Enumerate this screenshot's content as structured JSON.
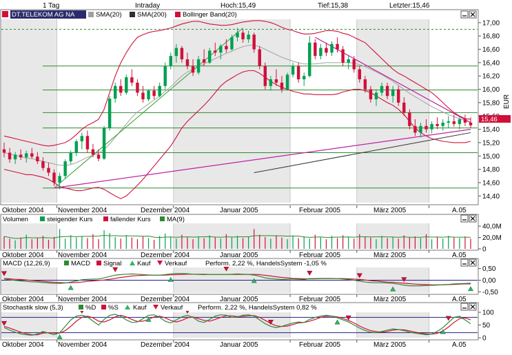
{
  "header": {
    "timeframe": "1 Tag",
    "mode": "Intraday",
    "high": "Hoch:15,49",
    "low": "Tief:15,38",
    "last": "Letzter:15,46"
  },
  "colors": {
    "candle_up": "#00a050",
    "candle_down": "#d0103a",
    "bollinger": "#d0103a",
    "sma20": "#a0a0a0",
    "sma200": "#303030",
    "hline": "#2f8a2f",
    "trend_green": "#2fa02f",
    "trend_magenta": "#c020a0",
    "ma": "#2f8a2f",
    "band_gray": "#e8e8e8",
    "grid_dash": "#2f8a2f"
  },
  "x_labels": [
    "Oktober 2004",
    "November 2004",
    "Dezember 2004",
    "Januar 2005",
    "Februar 2005",
    "März 2005",
    "A.05"
  ],
  "main_legend": {
    "title": "DT.TELEKOM AG NA",
    "items": [
      "SMA(20)",
      "SMA(200)",
      "Bollinger Band(20)"
    ]
  },
  "price_ticks": [
    "17,00",
    "16,80",
    "16,60",
    "16,40",
    "16,20",
    "16,00",
    "15,80",
    "15,60",
    "15,40",
    "15,20",
    "15,00",
    "14,80",
    "14,60",
    "14,40"
  ],
  "currency": "EUR",
  "last_price_label": "15,46",
  "volume_legend": {
    "items": [
      "Volumen",
      "steigender Kurs",
      "fallender Kurs",
      "MA(9)"
    ]
  },
  "volume_ticks": [
    "40,0M",
    "20,0M",
    "0"
  ],
  "macd_legend": {
    "items": [
      "MACD (12,26,9)",
      "MACD",
      "Signal",
      "Kauf",
      "Verkauf",
      "Perform. 2,22 %, HandelsSystem -1,05 %"
    ]
  },
  "macd_ticks": [
    "0,50",
    "0,00",
    "-0,50"
  ],
  "stoch_legend": {
    "items": [
      "Stochastik slow (5,3)",
      "%D",
      "%S",
      "Kauf",
      "Verkauf",
      "Perform. 2,22 %, HandelsSystem 0,82 %"
    ]
  },
  "stoch_ticks": [
    "100",
    "50",
    "0"
  ],
  "chart_data": {
    "type": "candlestick",
    "instrument": "DT.TELEKOM AG NA",
    "period": "Oktober 2004 – April 2005",
    "ylim": [
      14.3,
      17.05
    ],
    "ohlc": [
      [
        15.1,
        15.2,
        14.98,
        15.05
      ],
      [
        15.05,
        15.12,
        14.9,
        14.95
      ],
      [
        14.95,
        15.06,
        14.88,
        15.02
      ],
      [
        15.02,
        15.1,
        14.94,
        14.98
      ],
      [
        14.98,
        15.08,
        14.9,
        15.04
      ],
      [
        15.04,
        15.12,
        14.96,
        14.99
      ],
      [
        14.99,
        15.06,
        14.88,
        14.92
      ],
      [
        14.92,
        14.98,
        14.78,
        14.82
      ],
      [
        14.82,
        14.9,
        14.7,
        14.75
      ],
      [
        14.75,
        14.8,
        14.55,
        14.6
      ],
      [
        14.6,
        14.75,
        14.5,
        14.7
      ],
      [
        14.7,
        14.95,
        14.66,
        14.92
      ],
      [
        14.92,
        15.08,
        14.88,
        15.05
      ],
      [
        15.05,
        15.25,
        15.0,
        15.22
      ],
      [
        15.22,
        15.35,
        15.1,
        15.3
      ],
      [
        15.3,
        15.38,
        15.05,
        15.1
      ],
      [
        15.1,
        15.18,
        14.98,
        15.02
      ],
      [
        15.02,
        15.1,
        14.92,
        14.96
      ],
      [
        14.96,
        15.45,
        14.94,
        15.42
      ],
      [
        15.42,
        15.9,
        15.38,
        15.86
      ],
      [
        15.86,
        16.1,
        15.8,
        16.05
      ],
      [
        16.05,
        16.15,
        15.9,
        15.95
      ],
      [
        15.95,
        16.22,
        15.92,
        16.18
      ],
      [
        16.18,
        16.3,
        16.05,
        16.1
      ],
      [
        16.1,
        16.15,
        15.9,
        15.95
      ],
      [
        15.95,
        16.05,
        15.8,
        15.85
      ],
      [
        15.85,
        16.0,
        15.82,
        15.98
      ],
      [
        15.98,
        16.05,
        15.85,
        15.9
      ],
      [
        15.9,
        16.1,
        15.88,
        16.05
      ],
      [
        16.05,
        16.4,
        16.0,
        16.35
      ],
      [
        16.35,
        16.55,
        16.3,
        16.5
      ],
      [
        16.5,
        16.68,
        16.4,
        16.62
      ],
      [
        16.62,
        16.65,
        16.4,
        16.45
      ],
      [
        16.45,
        16.55,
        16.3,
        16.35
      ],
      [
        16.35,
        16.45,
        16.2,
        16.25
      ],
      [
        16.25,
        16.5,
        16.22,
        16.45
      ],
      [
        16.45,
        16.6,
        16.35,
        16.4
      ],
      [
        16.4,
        16.62,
        16.38,
        16.58
      ],
      [
        16.58,
        16.7,
        16.5,
        16.55
      ],
      [
        16.55,
        16.68,
        16.45,
        16.65
      ],
      [
        16.65,
        16.75,
        16.55,
        16.6
      ],
      [
        16.6,
        16.82,
        16.58,
        16.78
      ],
      [
        16.78,
        16.92,
        16.72,
        16.85
      ],
      [
        16.85,
        16.9,
        16.7,
        16.75
      ],
      [
        16.75,
        16.88,
        16.7,
        16.82
      ],
      [
        16.82,
        16.85,
        16.55,
        16.6
      ],
      [
        16.6,
        16.65,
        16.3,
        16.35
      ],
      [
        16.35,
        16.4,
        16.0,
        16.05
      ],
      [
        16.05,
        16.2,
        15.98,
        16.15
      ],
      [
        16.15,
        16.3,
        16.05,
        16.1
      ],
      [
        16.1,
        16.2,
        15.95,
        16.0
      ],
      [
        16.0,
        16.25,
        15.98,
        16.22
      ],
      [
        16.22,
        16.4,
        16.18,
        16.35
      ],
      [
        16.35,
        16.4,
        16.1,
        16.15
      ],
      [
        16.15,
        16.25,
        16.05,
        16.2
      ],
      [
        16.2,
        16.8,
        16.18,
        16.7
      ],
      [
        16.7,
        16.75,
        16.45,
        16.5
      ],
      [
        16.5,
        16.68,
        16.45,
        16.62
      ],
      [
        16.62,
        16.7,
        16.5,
        16.55
      ],
      [
        16.55,
        16.72,
        16.5,
        16.68
      ],
      [
        16.68,
        16.78,
        16.55,
        16.6
      ],
      [
        16.6,
        16.65,
        16.35,
        16.4
      ],
      [
        16.4,
        16.5,
        16.3,
        16.45
      ],
      [
        16.45,
        16.5,
        16.25,
        16.3
      ],
      [
        16.3,
        16.35,
        16.1,
        16.15
      ],
      [
        16.15,
        16.2,
        15.95,
        16.0
      ],
      [
        16.0,
        16.05,
        15.8,
        15.85
      ],
      [
        15.85,
        16.0,
        15.75,
        15.95
      ],
      [
        15.95,
        16.1,
        15.9,
        16.05
      ],
      [
        16.05,
        16.1,
        15.85,
        15.9
      ],
      [
        15.9,
        16.05,
        15.8,
        16.0
      ],
      [
        16.0,
        16.05,
        15.75,
        15.8
      ],
      [
        15.8,
        15.88,
        15.6,
        15.65
      ],
      [
        15.65,
        15.7,
        15.4,
        15.45
      ],
      [
        15.45,
        15.55,
        15.3,
        15.35
      ],
      [
        15.35,
        15.5,
        15.28,
        15.45
      ],
      [
        15.45,
        15.55,
        15.35,
        15.4
      ],
      [
        15.4,
        15.52,
        15.34,
        15.48
      ],
      [
        15.48,
        15.58,
        15.4,
        15.45
      ],
      [
        15.45,
        15.55,
        15.38,
        15.5
      ],
      [
        15.5,
        15.6,
        15.42,
        15.52
      ],
      [
        15.52,
        15.62,
        15.44,
        15.48
      ],
      [
        15.48,
        15.58,
        15.4,
        15.55
      ],
      [
        15.55,
        15.62,
        15.45,
        15.5
      ],
      [
        15.5,
        15.58,
        15.42,
        15.46
      ]
    ],
    "hlines": [
      16.9,
      16.35,
      15.99,
      15.65,
      15.42,
      15.05,
      14.52
    ],
    "sma20": [
      15.05,
      15.03,
      15.01,
      14.99,
      14.97,
      14.96,
      14.94,
      14.92,
      14.9,
      14.88,
      14.86,
      14.86,
      14.87,
      14.9,
      14.94,
      14.98,
      15.01,
      15.04,
      15.1,
      15.18,
      15.28,
      15.38,
      15.48,
      15.58,
      15.66,
      15.72,
      15.78,
      15.84,
      15.9,
      15.97,
      16.04,
      16.12,
      16.2,
      16.26,
      16.3,
      16.34,
      16.38,
      16.42,
      16.46,
      16.5,
      16.54,
      16.57,
      16.61,
      16.64,
      16.66,
      16.66,
      16.64,
      16.6,
      16.56,
      16.52,
      16.48,
      16.45,
      16.42,
      16.4,
      16.38,
      16.38,
      16.38,
      16.39,
      16.4,
      16.4,
      16.4,
      16.4,
      16.4,
      16.39,
      16.37,
      16.34,
      16.3,
      16.26,
      16.22,
      16.17,
      16.12,
      16.06,
      16.0,
      15.94,
      15.89,
      15.84,
      15.79,
      15.74,
      15.7,
      15.66,
      15.62,
      15.59,
      15.56,
      15.53,
      15.51
    ],
    "bb_upper": [
      15.3,
      15.28,
      15.26,
      15.24,
      15.22,
      15.2,
      15.18,
      15.16,
      15.15,
      15.16,
      15.18,
      15.2,
      15.25,
      15.32,
      15.4,
      15.46,
      15.5,
      15.55,
      15.7,
      15.95,
      16.2,
      16.4,
      16.55,
      16.68,
      16.78,
      16.82,
      16.85,
      16.87,
      16.88,
      16.9,
      16.92,
      16.95,
      16.98,
      17.0,
      17.02,
      17.02,
      17.0,
      16.98,
      16.97,
      16.96,
      16.96,
      16.97,
      16.99,
      17.01,
      17.02,
      17.03,
      17.03,
      17.02,
      17.0,
      16.97,
      16.93,
      16.9,
      16.88,
      16.85,
      16.83,
      16.83,
      16.84,
      16.86,
      16.88,
      16.88,
      16.87,
      16.84,
      16.82,
      16.78,
      16.74,
      16.7,
      16.62,
      16.54,
      16.46,
      16.38,
      16.3,
      16.24,
      16.2,
      16.15,
      16.1,
      16.05,
      16.0,
      15.95,
      15.88,
      15.8,
      15.72,
      15.65,
      15.6,
      15.56,
      15.55
    ],
    "bb_lower": [
      14.8,
      14.78,
      14.76,
      14.74,
      14.72,
      14.72,
      14.7,
      14.68,
      14.65,
      14.6,
      14.54,
      14.52,
      14.5,
      14.48,
      14.48,
      14.5,
      14.52,
      14.53,
      14.5,
      14.45,
      14.4,
      14.36,
      14.4,
      14.48,
      14.56,
      14.65,
      14.75,
      14.85,
      14.95,
      15.05,
      15.15,
      15.28,
      15.42,
      15.52,
      15.6,
      15.68,
      15.76,
      15.85,
      15.95,
      16.05,
      16.12,
      16.17,
      16.22,
      16.26,
      16.28,
      16.28,
      16.24,
      16.18,
      16.12,
      16.07,
      16.03,
      16.0,
      15.97,
      15.95,
      15.93,
      15.93,
      15.92,
      15.92,
      15.92,
      15.92,
      15.93,
      15.96,
      15.98,
      16.0,
      16.0,
      15.98,
      15.95,
      15.9,
      15.85,
      15.8,
      15.76,
      15.7,
      15.62,
      15.52,
      15.42,
      15.35,
      15.3,
      15.26,
      15.24,
      15.22,
      15.21,
      15.2,
      15.2,
      15.2,
      15.22
    ],
    "volume": [
      22,
      18,
      15,
      20,
      25,
      17,
      19,
      23,
      16,
      21,
      35,
      18,
      24,
      20,
      22,
      19,
      26,
      17,
      33,
      28,
      21,
      18,
      24,
      20,
      17,
      22,
      19,
      16,
      23,
      27,
      21,
      18,
      25,
      20,
      17,
      22,
      19,
      24,
      21,
      18,
      26,
      20,
      23,
      19,
      22,
      35,
      25,
      21,
      18,
      24,
      20,
      17,
      23,
      19,
      22,
      18,
      25,
      20,
      17,
      23,
      19,
      24,
      21,
      18,
      26,
      22,
      20,
      17,
      23,
      19,
      21,
      18,
      24,
      20,
      22,
      19,
      26,
      17,
      21,
      18,
      23,
      20,
      19,
      22,
      18
    ],
    "macd": [
      0.05,
      0.02,
      -0.01,
      -0.03,
      -0.05,
      -0.07,
      -0.08,
      -0.1,
      -0.12,
      -0.14,
      -0.14,
      -0.12,
      -0.08,
      -0.03,
      0.02,
      0.04,
      0.05,
      0.05,
      0.1,
      0.16,
      0.22,
      0.24,
      0.26,
      0.27,
      0.26,
      0.24,
      0.23,
      0.22,
      0.22,
      0.24,
      0.27,
      0.29,
      0.29,
      0.28,
      0.26,
      0.25,
      0.24,
      0.25,
      0.25,
      0.25,
      0.25,
      0.26,
      0.27,
      0.26,
      0.25,
      0.22,
      0.17,
      0.1,
      0.07,
      0.05,
      0.03,
      0.04,
      0.05,
      0.04,
      0.03,
      0.07,
      0.07,
      0.08,
      0.08,
      0.08,
      0.07,
      0.05,
      0.03,
      0.0,
      -0.04,
      -0.08,
      -0.1,
      -0.11,
      -0.11,
      -0.12,
      -0.14,
      -0.17,
      -0.21,
      -0.24,
      -0.24,
      -0.24,
      -0.23,
      -0.22,
      -0.21,
      -0.19,
      -0.18,
      -0.16,
      -0.15,
      -0.14,
      -0.13
    ],
    "macd_signal": [
      0.07,
      0.06,
      0.04,
      0.03,
      0.01,
      -0.01,
      -0.03,
      -0.05,
      -0.07,
      -0.09,
      -0.1,
      -0.11,
      -0.11,
      -0.1,
      -0.08,
      -0.05,
      -0.03,
      -0.01,
      0.01,
      0.04,
      0.08,
      0.12,
      0.15,
      0.18,
      0.2,
      0.21,
      0.22,
      0.22,
      0.22,
      0.22,
      0.23,
      0.24,
      0.25,
      0.26,
      0.26,
      0.26,
      0.26,
      0.25,
      0.25,
      0.25,
      0.25,
      0.25,
      0.25,
      0.25,
      0.25,
      0.25,
      0.24,
      0.21,
      0.18,
      0.15,
      0.12,
      0.1,
      0.08,
      0.07,
      0.06,
      0.06,
      0.06,
      0.07,
      0.07,
      0.07,
      0.07,
      0.07,
      0.06,
      0.05,
      0.03,
      0.01,
      -0.02,
      -0.04,
      -0.06,
      -0.08,
      -0.09,
      -0.11,
      -0.13,
      -0.15,
      -0.17,
      -0.18,
      -0.19,
      -0.2,
      -0.2,
      -0.2,
      -0.19,
      -0.18,
      -0.17,
      -0.16,
      -0.16
    ],
    "macd_kauf": [
      12,
      30,
      45,
      70,
      84
    ],
    "macd_verkauf": [
      0,
      20,
      40,
      55,
      64,
      72
    ],
    "stoch_k": [
      40,
      30,
      22,
      15,
      12,
      10,
      15,
      25,
      18,
      12,
      20,
      45,
      70,
      85,
      88,
      82,
      65,
      50,
      72,
      88,
      92,
      84,
      70,
      60,
      62,
      75,
      88,
      90,
      80,
      65,
      58,
      70,
      82,
      88,
      80,
      65,
      60,
      72,
      85,
      90,
      88,
      80,
      82,
      88,
      90,
      85,
      70,
      55,
      45,
      40,
      45,
      52,
      58,
      62,
      60,
      72,
      80,
      85,
      88,
      85,
      78,
      70,
      62,
      50,
      38,
      28,
      22,
      20,
      25,
      30,
      35,
      32,
      28,
      22,
      18,
      15,
      12,
      15,
      25,
      40,
      60,
      80,
      85,
      70,
      55
    ],
    "stoch_d": [
      45,
      38,
      30,
      22,
      16,
      12,
      12,
      18,
      20,
      18,
      18,
      28,
      45,
      65,
      80,
      85,
      78,
      65,
      62,
      70,
      82,
      88,
      82,
      72,
      64,
      65,
      72,
      82,
      85,
      78,
      68,
      62,
      68,
      78,
      82,
      75,
      68,
      65,
      72,
      80,
      86,
      86,
      83,
      84,
      86,
      87,
      80,
      68,
      56,
      47,
      44,
      46,
      52,
      58,
      60,
      65,
      72,
      80,
      84,
      85,
      82,
      76,
      68,
      58,
      46,
      36,
      28,
      24,
      22,
      25,
      30,
      32,
      31,
      27,
      22,
      18,
      15,
      14,
      17,
      27,
      42,
      60,
      75,
      78,
      70
    ],
    "stoch_kauf": [
      10,
      26,
      60,
      79
    ],
    "stoch_verkauf": [
      0,
      14,
      33,
      48,
      62,
      80
    ]
  }
}
